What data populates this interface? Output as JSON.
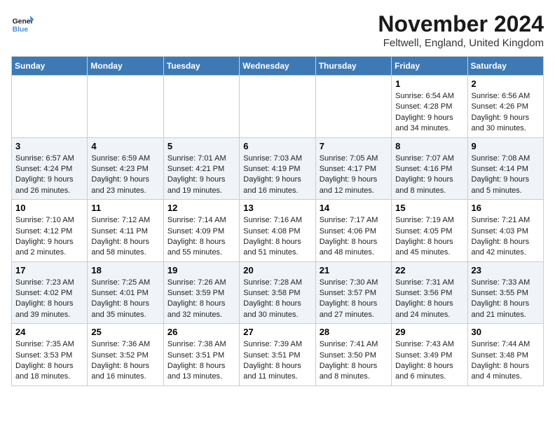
{
  "header": {
    "logo_line1": "General",
    "logo_line2": "Blue",
    "month": "November 2024",
    "location": "Feltwell, England, United Kingdom"
  },
  "weekdays": [
    "Sunday",
    "Monday",
    "Tuesday",
    "Wednesday",
    "Thursday",
    "Friday",
    "Saturday"
  ],
  "weeks": [
    [
      {
        "day": "",
        "info": ""
      },
      {
        "day": "",
        "info": ""
      },
      {
        "day": "",
        "info": ""
      },
      {
        "day": "",
        "info": ""
      },
      {
        "day": "",
        "info": ""
      },
      {
        "day": "1",
        "info": "Sunrise: 6:54 AM\nSunset: 4:28 PM\nDaylight: 9 hours and 34 minutes."
      },
      {
        "day": "2",
        "info": "Sunrise: 6:56 AM\nSunset: 4:26 PM\nDaylight: 9 hours and 30 minutes."
      }
    ],
    [
      {
        "day": "3",
        "info": "Sunrise: 6:57 AM\nSunset: 4:24 PM\nDaylight: 9 hours and 26 minutes."
      },
      {
        "day": "4",
        "info": "Sunrise: 6:59 AM\nSunset: 4:23 PM\nDaylight: 9 hours and 23 minutes."
      },
      {
        "day": "5",
        "info": "Sunrise: 7:01 AM\nSunset: 4:21 PM\nDaylight: 9 hours and 19 minutes."
      },
      {
        "day": "6",
        "info": "Sunrise: 7:03 AM\nSunset: 4:19 PM\nDaylight: 9 hours and 16 minutes."
      },
      {
        "day": "7",
        "info": "Sunrise: 7:05 AM\nSunset: 4:17 PM\nDaylight: 9 hours and 12 minutes."
      },
      {
        "day": "8",
        "info": "Sunrise: 7:07 AM\nSunset: 4:16 PM\nDaylight: 9 hours and 8 minutes."
      },
      {
        "day": "9",
        "info": "Sunrise: 7:08 AM\nSunset: 4:14 PM\nDaylight: 9 hours and 5 minutes."
      }
    ],
    [
      {
        "day": "10",
        "info": "Sunrise: 7:10 AM\nSunset: 4:12 PM\nDaylight: 9 hours and 2 minutes."
      },
      {
        "day": "11",
        "info": "Sunrise: 7:12 AM\nSunset: 4:11 PM\nDaylight: 8 hours and 58 minutes."
      },
      {
        "day": "12",
        "info": "Sunrise: 7:14 AM\nSunset: 4:09 PM\nDaylight: 8 hours and 55 minutes."
      },
      {
        "day": "13",
        "info": "Sunrise: 7:16 AM\nSunset: 4:08 PM\nDaylight: 8 hours and 51 minutes."
      },
      {
        "day": "14",
        "info": "Sunrise: 7:17 AM\nSunset: 4:06 PM\nDaylight: 8 hours and 48 minutes."
      },
      {
        "day": "15",
        "info": "Sunrise: 7:19 AM\nSunset: 4:05 PM\nDaylight: 8 hours and 45 minutes."
      },
      {
        "day": "16",
        "info": "Sunrise: 7:21 AM\nSunset: 4:03 PM\nDaylight: 8 hours and 42 minutes."
      }
    ],
    [
      {
        "day": "17",
        "info": "Sunrise: 7:23 AM\nSunset: 4:02 PM\nDaylight: 8 hours and 39 minutes."
      },
      {
        "day": "18",
        "info": "Sunrise: 7:25 AM\nSunset: 4:01 PM\nDaylight: 8 hours and 35 minutes."
      },
      {
        "day": "19",
        "info": "Sunrise: 7:26 AM\nSunset: 3:59 PM\nDaylight: 8 hours and 32 minutes."
      },
      {
        "day": "20",
        "info": "Sunrise: 7:28 AM\nSunset: 3:58 PM\nDaylight: 8 hours and 30 minutes."
      },
      {
        "day": "21",
        "info": "Sunrise: 7:30 AM\nSunset: 3:57 PM\nDaylight: 8 hours and 27 minutes."
      },
      {
        "day": "22",
        "info": "Sunrise: 7:31 AM\nSunset: 3:56 PM\nDaylight: 8 hours and 24 minutes."
      },
      {
        "day": "23",
        "info": "Sunrise: 7:33 AM\nSunset: 3:55 PM\nDaylight: 8 hours and 21 minutes."
      }
    ],
    [
      {
        "day": "24",
        "info": "Sunrise: 7:35 AM\nSunset: 3:53 PM\nDaylight: 8 hours and 18 minutes."
      },
      {
        "day": "25",
        "info": "Sunrise: 7:36 AM\nSunset: 3:52 PM\nDaylight: 8 hours and 16 minutes."
      },
      {
        "day": "26",
        "info": "Sunrise: 7:38 AM\nSunset: 3:51 PM\nDaylight: 8 hours and 13 minutes."
      },
      {
        "day": "27",
        "info": "Sunrise: 7:39 AM\nSunset: 3:51 PM\nDaylight: 8 hours and 11 minutes."
      },
      {
        "day": "28",
        "info": "Sunrise: 7:41 AM\nSunset: 3:50 PM\nDaylight: 8 hours and 8 minutes."
      },
      {
        "day": "29",
        "info": "Sunrise: 7:43 AM\nSunset: 3:49 PM\nDaylight: 8 hours and 6 minutes."
      },
      {
        "day": "30",
        "info": "Sunrise: 7:44 AM\nSunset: 3:48 PM\nDaylight: 8 hours and 4 minutes."
      }
    ]
  ]
}
